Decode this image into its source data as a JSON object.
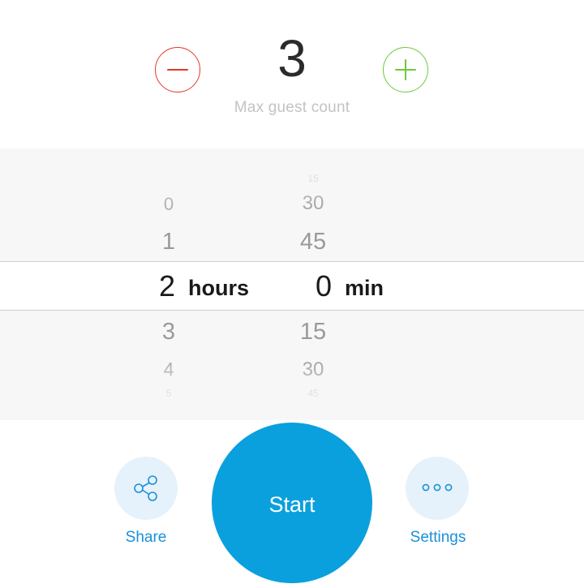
{
  "guest_counter": {
    "count": "3",
    "label": "Max guest count",
    "minus_color": "#e4372b",
    "plus_color": "#6cc93b",
    "minus_icon": "minus-icon",
    "plus_icon": "plus-icon"
  },
  "picker": {
    "hours": {
      "above": [
        "0",
        "1"
      ],
      "selected": "2",
      "unit": "hours",
      "below": [
        "3",
        "4",
        "5"
      ]
    },
    "minutes": {
      "above": [
        "15",
        "30",
        "45"
      ],
      "selected": "0",
      "unit": "min",
      "below": [
        "15",
        "30",
        "45"
      ]
    }
  },
  "actions": {
    "share_label": "Share",
    "share_icon": "share-icon",
    "start_label": "Start",
    "settings_label": "Settings",
    "settings_icon": "more-dots-icon",
    "accent_color": "#0aa0dd"
  }
}
